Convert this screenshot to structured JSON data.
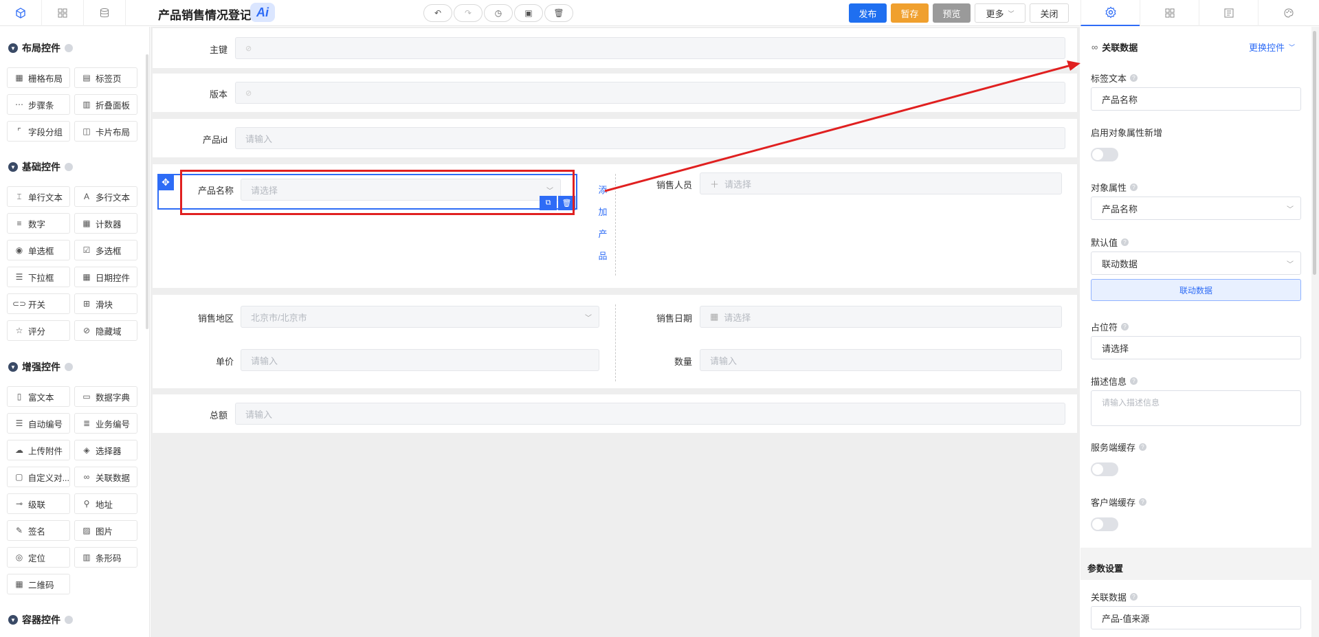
{
  "header": {
    "title": "产品销售情况登记",
    "ai_badge": "Ai",
    "buttons": {
      "publish": "发布",
      "draft": "暂存",
      "preview": "预览",
      "more": "更多",
      "close": "关闭"
    },
    "left_tabs": [
      "widget-icon",
      "grid-icon",
      "database-icon"
    ],
    "right_tabs": [
      "gear-icon",
      "grid-icon",
      "form-icon",
      "palette-icon"
    ],
    "colors": {
      "publish": "#1f6ff0",
      "draft": "#f0a02e",
      "preview": "#999999",
      "accent": "#2e6cf6",
      "highlight": "#e02020"
    }
  },
  "sidebar": {
    "layout": {
      "title": "布局控件",
      "items": [
        "栅格布局",
        "标签页",
        "步骤条",
        "折叠面板",
        "字段分组",
        "卡片布局"
      ]
    },
    "basic": {
      "title": "基础控件",
      "items": [
        "单行文本",
        "多行文本",
        "数字",
        "计数器",
        "单选框",
        "多选框",
        "下拉框",
        "日期控件",
        "开关",
        "滑块",
        "评分",
        "隐藏域"
      ]
    },
    "enhanced": {
      "title": "增强控件",
      "items": [
        "富文本",
        "数据字典",
        "自动编号",
        "业务编号",
        "上传附件",
        "选择器",
        "自定义对...",
        "关联数据",
        "级联",
        "地址",
        "签名",
        "图片",
        "定位",
        "条形码",
        "二维码"
      ]
    },
    "container": {
      "title": "容器控件"
    }
  },
  "form": {
    "primary_key": {
      "label": "主键"
    },
    "version": {
      "label": "版本"
    },
    "product_id": {
      "label": "产品id",
      "placeholder": "请输入"
    },
    "product_name": {
      "label": "产品名称",
      "placeholder": "请选择"
    },
    "add_product": [
      "添",
      "加",
      "产",
      "品"
    ],
    "salesperson": {
      "label": "销售人员",
      "placeholder": "请选择"
    },
    "region": {
      "label": "销售地区",
      "placeholder": "北京市/北京市"
    },
    "sale_date": {
      "label": "销售日期",
      "placeholder": "请选择"
    },
    "unit_price": {
      "label": "单价",
      "placeholder": "请输入"
    },
    "quantity": {
      "label": "数量",
      "placeholder": "请输入"
    },
    "total": {
      "label": "总额",
      "placeholder": "请输入"
    }
  },
  "panel": {
    "widget_type": "关联数据",
    "switch_widget": "更换控件",
    "label_text": {
      "label": "标签文本",
      "value": "产品名称"
    },
    "enable_obj_attr": {
      "label": "启用对象属性新增"
    },
    "obj_attr": {
      "label": "对象属性",
      "value": "产品名称"
    },
    "default_value": {
      "label": "默认值",
      "value": "联动数据",
      "button": "联动数据"
    },
    "placeholder": {
      "label": "占位符",
      "value": "请选择"
    },
    "description": {
      "label": "描述信息",
      "placeholder": "请输入描述信息"
    },
    "server_cache": {
      "label": "服务端缓存"
    },
    "client_cache": {
      "label": "客户端缓存"
    },
    "params_title": "参数设置",
    "related_data": {
      "label": "关联数据",
      "value": "产品-值来源"
    }
  }
}
